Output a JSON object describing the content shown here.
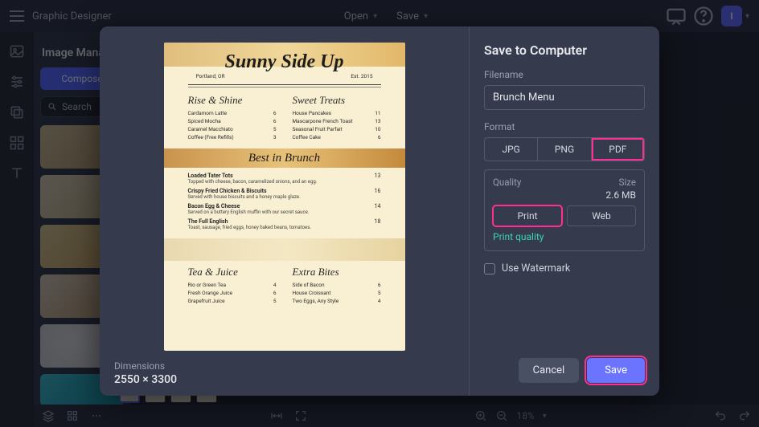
{
  "app": {
    "title": "Graphic Designer"
  },
  "topbar": {
    "open": "Open",
    "save": "Save",
    "avatar_initial": "I"
  },
  "sidepanel": {
    "title": "Image Manager",
    "compose_btn": "Compose",
    "search_placeholder": "Search"
  },
  "modal": {
    "title": "Save to Computer",
    "filename_label": "Filename",
    "filename_value": "Brunch Menu",
    "format_label": "Format",
    "formats": {
      "jpg": "JPG",
      "png": "PNG",
      "pdf": "PDF"
    },
    "quality_label": "Quality",
    "size_label": "Size",
    "size_value": "2.6 MB",
    "qualities": {
      "print": "Print",
      "web": "Web"
    },
    "print_quality_link": "Print quality",
    "watermark_label": "Use Watermark",
    "dimensions_label": "Dimensions",
    "dimensions_value": "2550 × 3300",
    "cancel": "Cancel",
    "save": "Save"
  },
  "statusbar": {
    "zoom": "18%"
  },
  "preview": {
    "title": "Sunny Side Up",
    "sub_left": "Portland, OR",
    "sub_right": "Est. 2015",
    "sec1_left": "Rise & Shine",
    "sec1_right": "Sweet Treats",
    "col1": [
      {
        "n": "Cardamom Latte",
        "p": "6"
      },
      {
        "n": "Spiced Mocha",
        "p": "6"
      },
      {
        "n": "Caramel Macchiato",
        "p": "5"
      },
      {
        "n": "Coffee (Free Refills)",
        "p": "3"
      }
    ],
    "col2": [
      {
        "n": "House Pancakes",
        "p": "11"
      },
      {
        "n": "Mascarpone French Toast",
        "p": "13"
      },
      {
        "n": "Seasonal Fruit Parfait",
        "p": "10"
      },
      {
        "n": "Coffee Cake",
        "p": "6"
      }
    ],
    "band2": "Best in Brunch",
    "list": [
      {
        "n": "Loaded Tater Tots",
        "d": "Topped with cheese, bacon, caramelized onions, and an egg.",
        "p": "13"
      },
      {
        "n": "Crispy Fried Chicken & Biscuits",
        "d": "Served with house biscuits and a honey maple glaze.",
        "p": "16"
      },
      {
        "n": "Bacon Egg & Cheese",
        "d": "Served on a buttery English muffin with our secret sauce.",
        "p": "14"
      },
      {
        "n": "The Full English",
        "d": "Toast, sausage, fried eggs, honey baked beans, tomatoes.",
        "p": "18"
      }
    ],
    "sec3_left": "Tea & Juice",
    "sec3_right": "Extra Bites",
    "col3": [
      {
        "n": "Rio or Green Tea",
        "p": "4"
      },
      {
        "n": "Fresh Orange Juice",
        "p": "6"
      },
      {
        "n": "Grapefruit Juice",
        "p": "5"
      }
    ],
    "col4": [
      {
        "n": "Side of Bacon",
        "p": "6"
      },
      {
        "n": "House Croissant",
        "p": "5"
      },
      {
        "n": "Two Eggs, Any Style",
        "p": "4"
      }
    ]
  },
  "colors": {
    "accent": "#5a64ff",
    "highlight": "#ff2e94"
  },
  "chart_data": null
}
